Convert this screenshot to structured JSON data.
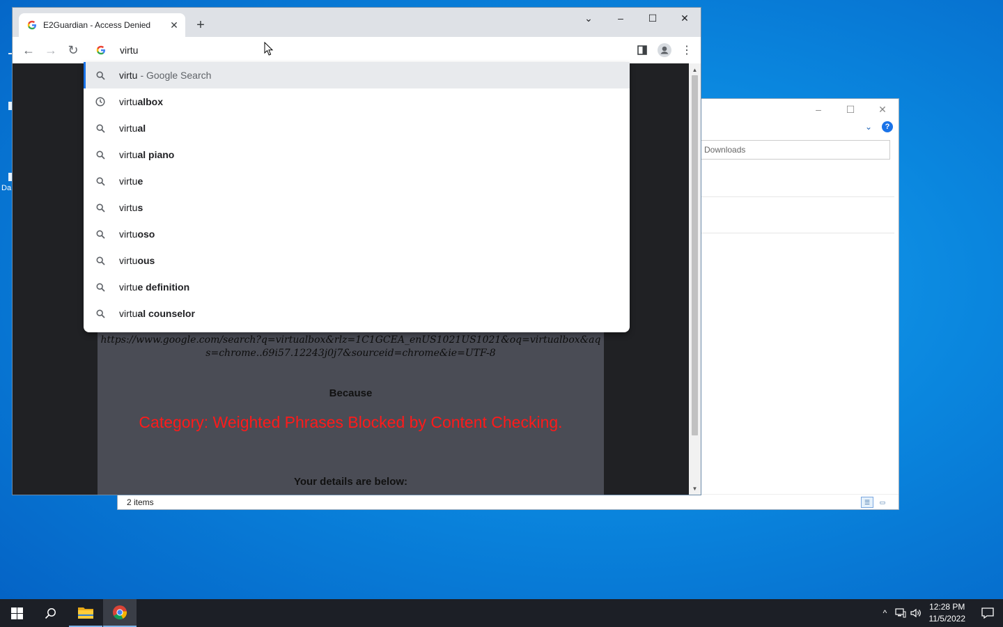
{
  "desktop": {
    "icon_label_fragment": "Da"
  },
  "explorer": {
    "minimize": "–",
    "maximize": "☐",
    "close": "✕",
    "help": "?",
    "search_placeholder": "h Downloads",
    "status_items": "2 items"
  },
  "chrome": {
    "tab_title": "E2Guardian - Access Denied",
    "tab_close": "✕",
    "new_tab": "+",
    "tab_search": "⌄",
    "minimize": "–",
    "maximize": "☐",
    "close": "✕",
    "back": "←",
    "forward": "→",
    "reload": "↻",
    "omnibox_value": "virtu",
    "menu": "⋮"
  },
  "suggestions": [
    {
      "icon": "search-icon",
      "typed": "virtu",
      "rest": "",
      "sub": "- Google Search",
      "selected": true
    },
    {
      "icon": "history-icon",
      "typed": "virtu",
      "rest": "albox",
      "sub": ""
    },
    {
      "icon": "search-icon",
      "typed": "virtu",
      "rest": "al",
      "sub": ""
    },
    {
      "icon": "search-icon",
      "typed": "virtu",
      "rest": "al piano",
      "sub": ""
    },
    {
      "icon": "search-icon",
      "typed": "virtu",
      "rest": "e",
      "sub": ""
    },
    {
      "icon": "search-icon",
      "typed": "virtu",
      "rest": "s",
      "sub": ""
    },
    {
      "icon": "search-icon",
      "typed": "virtu",
      "rest": "oso",
      "sub": ""
    },
    {
      "icon": "search-icon",
      "typed": "virtu",
      "rest": "ous",
      "sub": ""
    },
    {
      "icon": "search-icon",
      "typed": "virtu",
      "rest": "e definition",
      "sub": ""
    },
    {
      "icon": "search-icon",
      "typed": "virtu",
      "rest": "al counselor",
      "sub": ""
    }
  ],
  "blockpage": {
    "url": "https://www.google.com/search?q=virtualbox&rlz=1C1GCEA_enUS1021US1021&oq=virtualbox&aqs=chrome..69i57.12243j0j7&sourceid=chrome&ie=UTF-8",
    "because": "Because",
    "category": "Category: Weighted Phrases  Blocked by Content Checking.",
    "details": "Your details are below:"
  },
  "taskbar": {
    "time": "12:28 PM",
    "date": "11/5/2022",
    "tray_chevron": "^"
  },
  "colors": {
    "block_reason": "#ff1a1a",
    "accent": "#1a73e8",
    "taskbar": "#1c1f26"
  }
}
